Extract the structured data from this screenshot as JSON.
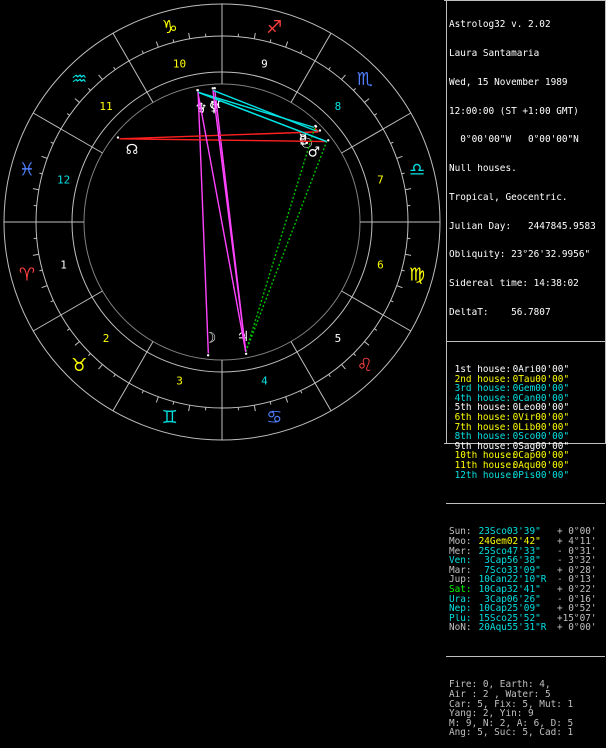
{
  "colors": {
    "background": "#000000",
    "wheel": "#bfbfbf",
    "fire": "#ff4040",
    "earth": "#ffff00",
    "air": "#00e0e0",
    "water": "#5080ff",
    "aspect_square": "#ff2020",
    "aspect_trine": "#00c000",
    "aspect_sextile": "#00e0e0",
    "aspect_opposition": "#ff44ff"
  },
  "header": {
    "title": "Astrolog32 v. 2.02",
    "name": "Laura Santamaria",
    "date": "Wed, 15 November 1989",
    "time": "12:00:00 (ST +1:00 GMT)",
    "location": "  0°00'00\"W   0°00'00\"N",
    "house_system": "Null houses.",
    "zodiac": "Tropical, Geocentric.",
    "julian_day": "Julian Day:   2447845.9583",
    "obliquity": "Obliquity: 23°26'32.9956\"",
    "sidereal_time": "Sidereal time: 14:38:02",
    "delta_t": "DeltaT:    56.7807"
  },
  "houses": [
    {
      "label": "1st house:",
      "value": " 0Ari00'00\"",
      "color": "#ffffff"
    },
    {
      "label": "2nd house:",
      "value": " 0Tau00'00\"",
      "color": "#ffff00"
    },
    {
      "label": "3rd house:",
      "value": " 0Gem00'00\"",
      "color": "#00e0e0"
    },
    {
      "label": "4th house:",
      "value": " 0Can00'00\"",
      "color": "#00e0e0"
    },
    {
      "label": "5th house:",
      "value": " 0Leo00'00\"",
      "color": "#ffffff"
    },
    {
      "label": "6th house:",
      "value": " 0Vir00'00\"",
      "color": "#ffff00"
    },
    {
      "label": "7th house:",
      "value": " 0Lib00'00\"",
      "color": "#ffff00"
    },
    {
      "label": "8th house:",
      "value": " 0Sco00'00\"",
      "color": "#00e0e0"
    },
    {
      "label": "9th house:",
      "value": " 0Sag00'00\"",
      "color": "#ffffff"
    },
    {
      "label": "10th house:",
      "value": " 0Cap00'00\"",
      "color": "#ffff00"
    },
    {
      "label": "11th house:",
      "value": " 0Aqu00'00\"",
      "color": "#ffff00"
    },
    {
      "label": "12th house:",
      "value": " 0Pis00'00\"",
      "color": "#00e0e0"
    }
  ],
  "planets": [
    {
      "name": "Sun:",
      "position": " 23Sco03'39\"",
      "speed": "+ 0°00'",
      "color": "#c0c0c0",
      "pcolor": "#00e0e0"
    },
    {
      "name": "Moo:",
      "position": " 24Gem02'42\"",
      "speed": "+ 4°11'",
      "color": "#c0c0c0",
      "pcolor": "#ffff00"
    },
    {
      "name": "Mer:",
      "position": " 25Sco47'33\"",
      "speed": "- 0°31'",
      "color": "#c0c0c0",
      "pcolor": "#00e0e0"
    },
    {
      "name": "Ven:",
      "position": "  3Cap56'38\"",
      "speed": "- 3°32'",
      "color": "#00e0e0",
      "pcolor": "#00e0e0"
    },
    {
      "name": "Mar:",
      "position": "  7Sco33'09\"",
      "speed": "+ 0°28'",
      "color": "#c0c0c0",
      "pcolor": "#00e0e0"
    },
    {
      "name": "Jup:",
      "position": " 10Can22'10\"R",
      "speed": "- 0°13'",
      "color": "#c0c0c0",
      "pcolor": "#00e0e0"
    },
    {
      "name": "Sat:",
      "position": " 10Cap32'41\"",
      "speed": "+ 0°22'",
      "color": "#00ff00",
      "pcolor": "#00e0e0"
    },
    {
      "name": "Ura:",
      "position": "  3Cap06'26\"",
      "speed": "- 0°16'",
      "color": "#00e0e0",
      "pcolor": "#00e0e0"
    },
    {
      "name": "Nep:",
      "position": " 10Cap25'09\"",
      "speed": "+ 0°52'",
      "color": "#00e0e0",
      "pcolor": "#00e0e0"
    },
    {
      "name": "Plu:",
      "position": " 15Sco25'52\"",
      "speed": "+15°07'",
      "color": "#00e0e0",
      "pcolor": "#00e0e0"
    },
    {
      "name": "NoN:",
      "position": " 20Aqu55'31\"R",
      "speed": "+ 0°00'",
      "color": "#c0c0c0",
      "pcolor": "#00e0e0"
    }
  ],
  "summary": [
    "Fire: 0, Earth: 4,",
    "Air : 2 , Water: 5",
    "Car: 5, Fix: 5, Mut: 1",
    "Yang: 2, Yin: 9",
    "M: 9, N: 2, A: 6, D: 5",
    "Ang: 5, Suc: 5, Cad: 1"
  ],
  "wheel": {
    "sign_glyphs": [
      "♈",
      "♉",
      "♊",
      "♋",
      "♌",
      "♍",
      "♎",
      "♏",
      "♐",
      "♑",
      "♒",
      "♓"
    ],
    "house_numbers": [
      "1",
      "2",
      "3",
      "4",
      "5",
      "6",
      "7",
      "8",
      "9",
      "10",
      "11",
      "12"
    ],
    "house_number_colors": [
      "#ffffff",
      "#ffff00",
      "#ffff00",
      "#00e0e0",
      "#ffffff",
      "#ffff00",
      "#ffff00",
      "#00e0e0",
      "#ffffff",
      "#ffff00",
      "#ffff00",
      "#00e0e0"
    ]
  },
  "wheel_planets": [
    {
      "glyph": "☉",
      "lon": 223.06,
      "color": "#ffffff"
    },
    {
      "glyph": "☽",
      "lon": 84.05,
      "color": "#ffffff"
    },
    {
      "glyph": "☿",
      "lon": 225.79,
      "color": "#ffffff"
    },
    {
      "glyph": "♀",
      "lon": 273.94,
      "color": "#ffffff"
    },
    {
      "glyph": "♂",
      "lon": 217.55,
      "color": "#ffffff"
    },
    {
      "glyph": "♃",
      "lon": 100.37,
      "color": "#ffffff"
    },
    {
      "glyph": "♄",
      "lon": 280.54,
      "color": "#ffffff"
    },
    {
      "glyph": "♅",
      "lon": 273.11,
      "color": "#ffffff"
    },
    {
      "glyph": "♆",
      "lon": 280.42,
      "color": "#ffffff"
    },
    {
      "glyph": "♇",
      "lon": 225.43,
      "color": "#ffffff"
    },
    {
      "glyph": "☊",
      "lon": 320.93,
      "color": "#ffffff"
    }
  ]
}
